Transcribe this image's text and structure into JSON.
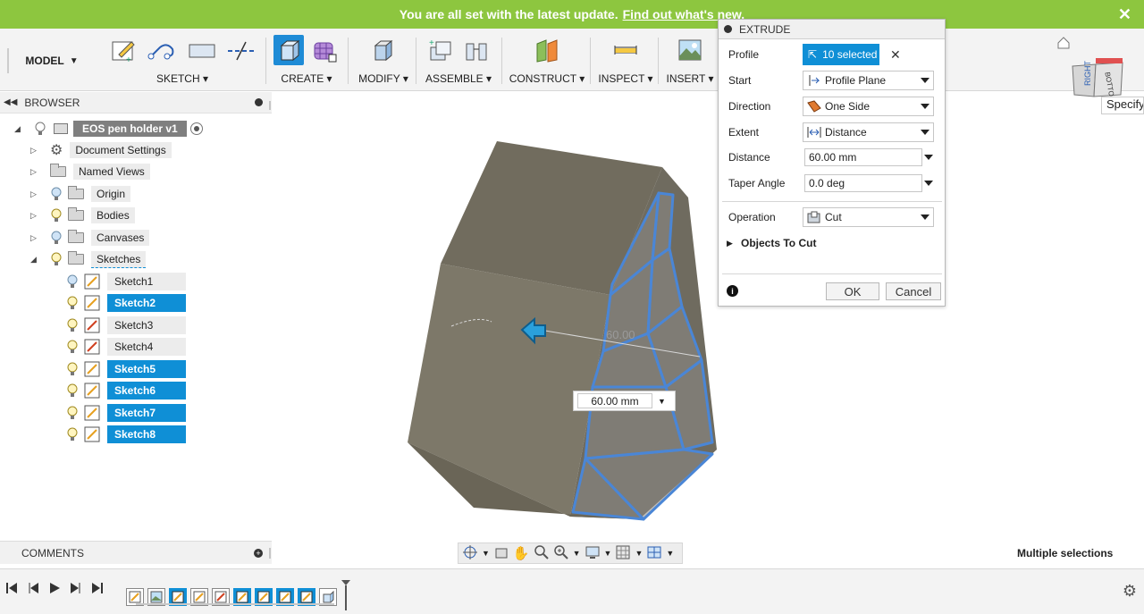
{
  "banner": {
    "message": "You are all set with the latest update.",
    "link": "Find out what's new.",
    "close": "✕"
  },
  "toolbar": {
    "model": "MODEL",
    "groups": [
      {
        "label": "SKETCH"
      },
      {
        "label": "CREATE"
      },
      {
        "label": "MODIFY"
      },
      {
        "label": "ASSEMBLE"
      },
      {
        "label": "CONSTRUCT"
      },
      {
        "label": "INSPECT"
      },
      {
        "label": "INSERT"
      }
    ]
  },
  "browser": {
    "title": "BROWSER",
    "root": "EOS pen holder v1",
    "items": [
      {
        "label": "Document Settings"
      },
      {
        "label": "Named Views"
      },
      {
        "label": "Origin"
      },
      {
        "label": "Bodies"
      },
      {
        "label": "Canvases"
      },
      {
        "label": "Sketches"
      }
    ],
    "sketches": [
      {
        "label": "Sketch1",
        "selected": false
      },
      {
        "label": "Sketch2",
        "selected": true
      },
      {
        "label": "Sketch3",
        "selected": false
      },
      {
        "label": "Sketch4",
        "selected": false
      },
      {
        "label": "Sketch5",
        "selected": true
      },
      {
        "label": "Sketch6",
        "selected": true
      },
      {
        "label": "Sketch7",
        "selected": true
      },
      {
        "label": "Sketch8",
        "selected": true
      }
    ]
  },
  "comments": {
    "title": "COMMENTS"
  },
  "canvas": {
    "distance_readout": "60.00 mm",
    "ghost_dimension": "60.00"
  },
  "status": {
    "selection": "Multiple selections"
  },
  "viewcube": {
    "right": "RIGHT",
    "bottom": "BOTTOM",
    "tooltip": "Specify"
  },
  "extrude": {
    "title": "EXTRUDE",
    "profile_label": "Profile",
    "profile_value": "10 selected",
    "clear": "✕",
    "start_label": "Start",
    "start_value": "Profile Plane",
    "direction_label": "Direction",
    "direction_value": "One Side",
    "extent_label": "Extent",
    "extent_value": "Distance",
    "distance_label": "Distance",
    "distance_value": "60.00 mm",
    "taper_label": "Taper Angle",
    "taper_value": "0.0 deg",
    "operation_label": "Operation",
    "operation_value": "Cut",
    "objects_label": "Objects To Cut",
    "ok": "OK",
    "cancel": "Cancel"
  },
  "colors": {
    "accent": "#0f8fd6",
    "banner": "#8dc63f",
    "body": "#7c7769"
  }
}
